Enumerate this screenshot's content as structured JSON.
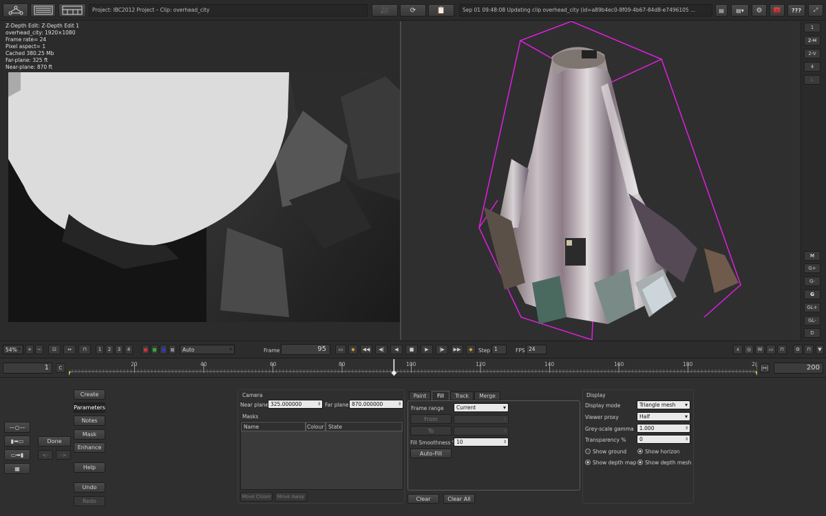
{
  "header": {
    "project": "Project: IBC2012 Project – Clip: overhead_city",
    "status": "Sep 01 09:48:08 Updating clip overhead_city (id=a89b4ec0-8f09-4b67-84d8-e7496105 ..."
  },
  "top_right_buttons": [
    "???"
  ],
  "overlay_info": [
    "Z-Depth Edit: Z-Depth Edit 1",
    "overhead_city: 1920×1080",
    "Frame rate= 24",
    "Pixel aspect= 1",
    "Cached 380.25 Mb",
    "Far-plane: 325 ft",
    "Near-plane: 870 ft"
  ],
  "right_sidebar": [
    "1",
    "2-H",
    "2-V",
    "4",
    "L"
  ],
  "right_sidebar_lower": [
    "M",
    "G+",
    "G-",
    "G",
    "GL+",
    "GL-",
    "D"
  ],
  "transport": {
    "zoom": "54%",
    "view_buttons": [
      "1",
      "2",
      "3",
      "4"
    ],
    "mode": "Auto",
    "frame_label": "Frame",
    "frame_value": "95",
    "step_label": "Step",
    "step_value": "1",
    "fps_label": "FPS",
    "fps_value": "24"
  },
  "timeline": {
    "start": "1",
    "start_btn": "C",
    "end": "200",
    "ticks": [
      "20",
      "40",
      "60",
      "80",
      "100",
      "120",
      "140",
      "160",
      "180",
      "2("
    ],
    "current_frame": 95
  },
  "left_panel": {
    "done": "Done",
    "back": "<-",
    "fwd": "->",
    "menu": [
      "Create",
      "Parameters",
      "Notes",
      "Mask",
      "Enhance"
    ],
    "help": "Help",
    "undo": "Undo",
    "redo": "Redo"
  },
  "camera": {
    "title": "Camera",
    "near_label": "Near plane",
    "near_value": "325.000000",
    "far_label": "Far plane",
    "far_value": "870.000000"
  },
  "masks": {
    "title": "Masks",
    "columns": [
      "Name",
      "Colour",
      "State"
    ],
    "move_closer": "Move Closer",
    "move_away": "Move Away"
  },
  "fill_panel": {
    "tabs": [
      "Paint",
      "Fill",
      "Track",
      "Merge"
    ],
    "active_tab": "Fill",
    "frame_range_label": "Frame range",
    "frame_range_value": "Current",
    "from": "From",
    "to": "To",
    "smoothness_label": "Fill Smoothness %",
    "smoothness_value": "10",
    "auto_fill": "Auto-Fill",
    "clear": "Clear",
    "clear_all": "Clear All"
  },
  "display": {
    "title": "Display",
    "display_mode_label": "Display mode",
    "display_mode_value": "Triangle mesh",
    "viewer_proxy_label": "Viewer proxy",
    "viewer_proxy_value": "Half",
    "gamma_label": "Grey-scale gamma",
    "gamma_value": "1.000",
    "transparency_label": "Transparency %",
    "transparency_value": "0",
    "show_ground": "Show ground",
    "show_horizon": "Show horizon",
    "show_depth_map": "Show depth map",
    "show_depth_mesh": "Show depth mesh"
  }
}
